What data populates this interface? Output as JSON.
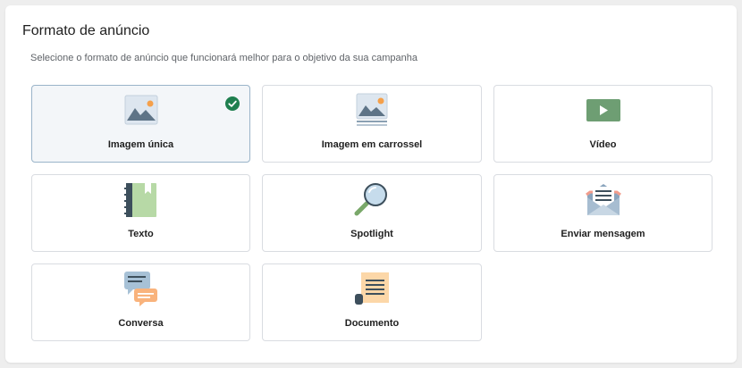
{
  "section": {
    "title": "Formato de anúncio",
    "subtitle": "Selecione o formato de anúncio que funcionará melhor para o objetivo da sua campanha"
  },
  "formats": [
    {
      "label": "Imagem única",
      "icon": "image-icon",
      "selected": true
    },
    {
      "label": "Imagem em carrossel",
      "icon": "carousel-image-icon",
      "selected": false
    },
    {
      "label": "Vídeo",
      "icon": "video-icon",
      "selected": false
    },
    {
      "label": "Texto",
      "icon": "notebook-icon",
      "selected": false
    },
    {
      "label": "Spotlight",
      "icon": "magnifier-icon",
      "selected": false
    },
    {
      "label": "Enviar mensagem",
      "icon": "envelope-icon",
      "selected": false
    },
    {
      "label": "Conversa",
      "icon": "chat-bubbles-icon",
      "selected": false
    },
    {
      "label": "Documento",
      "icon": "document-icon",
      "selected": false
    }
  ],
  "colors": {
    "selected_bg": "#f3f6f9",
    "selected_border": "#9ab4c9",
    "check_green": "#1e7f4f"
  }
}
